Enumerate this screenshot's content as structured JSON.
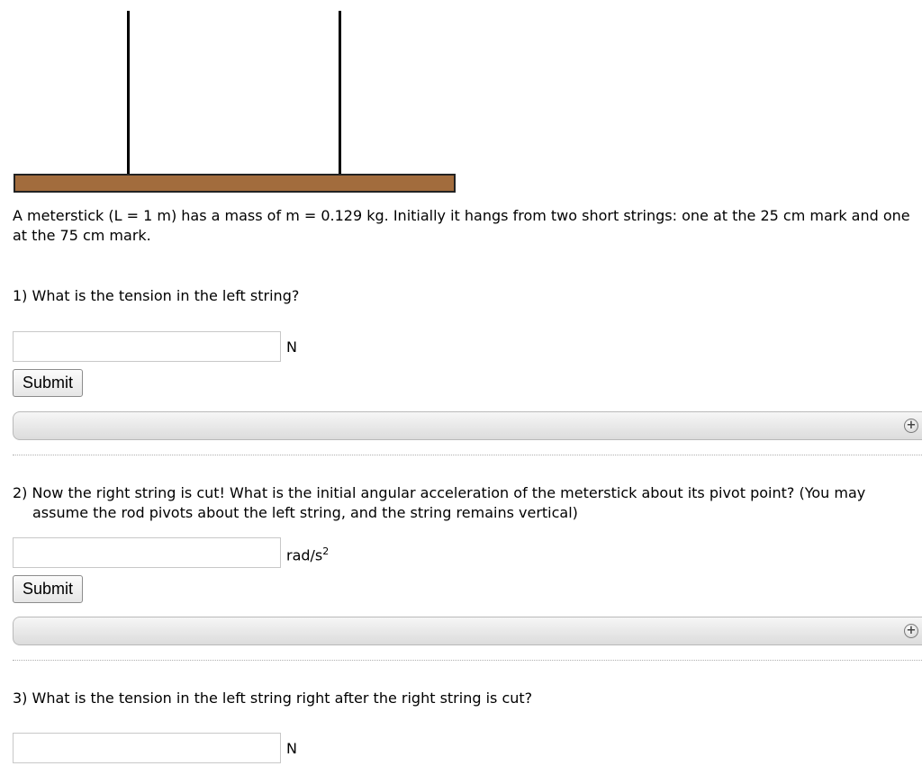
{
  "intro": "A meterstick (L = 1 m) has a mass of m = 0.129 kg. Initially it hangs from two short strings: one at the 25 cm mark and one at the 75 cm mark.",
  "questions": [
    {
      "text": "1) What is the tension in the left string?",
      "unit": "N",
      "submit_label": "Submit"
    },
    {
      "text": "2) Now the right string is cut! What is the initial angular acceleration of the meterstick about its pivot point? (You may assume the rod pivots about the left string, and the string remains vertical)",
      "unit_base": "rad/s",
      "unit_exp": "2",
      "submit_label": "Submit"
    },
    {
      "text": "3) What is the tension in the left string right after the right string is cut?",
      "unit": "N"
    }
  ],
  "colors": {
    "meterstick": "#a26c3d",
    "string": "#000000"
  },
  "icons": {
    "expand": "plus-icon"
  },
  "hint_expand_symbol": "+"
}
